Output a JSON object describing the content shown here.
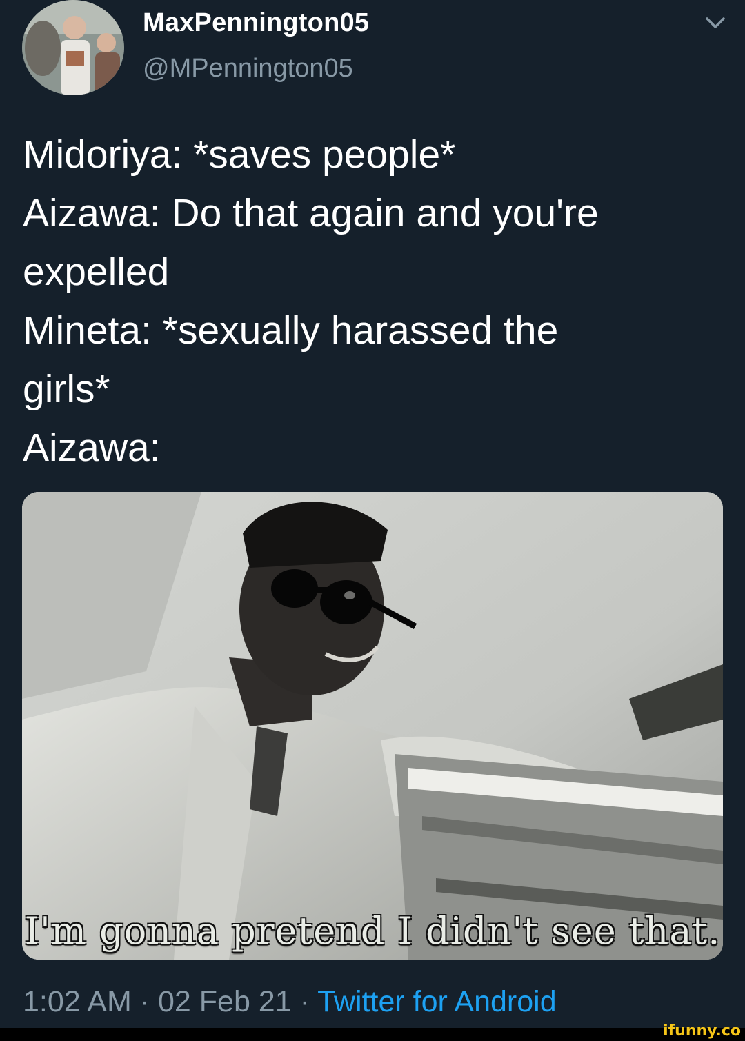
{
  "tweet": {
    "display_name": "MaxPennington05",
    "handle": "@MPennington05",
    "lines": [
      "Midoriya: *saves people*",
      "Aizawa: Do that again and you're",
      "expelled",
      "Mineta: *sexually harassed the",
      "girls*",
      "Aizawa:"
    ],
    "media_caption": "I'm gonna pretend I didn't see that.",
    "time": "1:02 AM",
    "date": "02 Feb 21",
    "separator": " · ",
    "source": "Twitter for Android"
  },
  "watermark": "ifunny.co",
  "colors": {
    "background": "#15202b",
    "secondary_text": "#8899a6",
    "link": "#1da1f2",
    "watermark": "#f5c518"
  },
  "icons": {
    "more": "chevron-down-icon"
  }
}
